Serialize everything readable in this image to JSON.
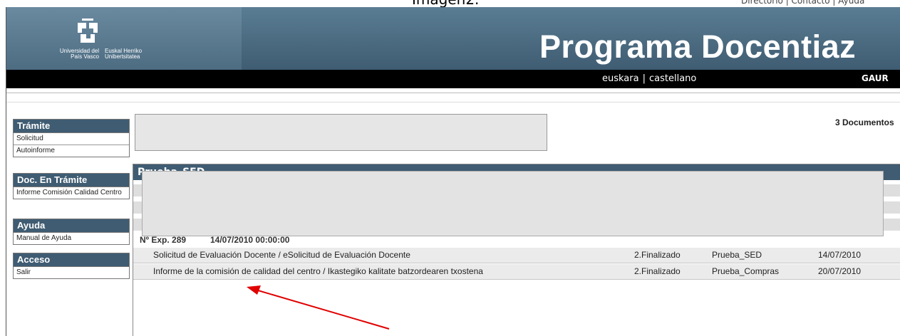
{
  "caption": {
    "title": "Imagen2.",
    "top_links": "Directorio | Contacto | Ayuda"
  },
  "header": {
    "university_es": "Universidad del País Vasco",
    "university_eu": "Euskal Herriko Unibertsitatea",
    "title": "Programa Docentiaz"
  },
  "langbar": {
    "lang_eu": "euskara",
    "separator": "|",
    "lang_es": "castellano",
    "right_text": "GAUR"
  },
  "sidebar": {
    "tramite": {
      "heading": "Trámite",
      "items": [
        "Solicitud",
        "Autoinforme"
      ]
    },
    "doc_en_tramite": {
      "heading": "Doc. En Trámite",
      "items": [
        "Informe Comisión Calidad Centro"
      ]
    },
    "ayuda": {
      "heading": "Ayuda",
      "items": [
        "Manual de Ayuda"
      ]
    },
    "acceso": {
      "heading": "Acceso",
      "items": [
        "Salir"
      ]
    }
  },
  "main": {
    "doc_count": "3 Documentos",
    "results_header": "Prueba_SED",
    "expediente": {
      "number": "Nº Exp. 289",
      "datetime": "14/07/2010 00:00:00"
    },
    "documents": [
      {
        "title": "Solicitud de Evaluación Docente / eSolicitud de Evaluación Docente",
        "status": "2.Finalizado",
        "expediente": "Prueba_SED",
        "date": "14/07/2010"
      },
      {
        "title": "Informe de la comisión de calidad del centro / Ikastegiko kalitate batzordearen txostena",
        "status": "2.Finalizado",
        "expediente": "Prueba_Compras",
        "date": "20/07/2010"
      }
    ]
  },
  "colors": {
    "header_blue": "#3f5c72",
    "langbar": "#000000",
    "annotation_arrow": "#e00000"
  }
}
